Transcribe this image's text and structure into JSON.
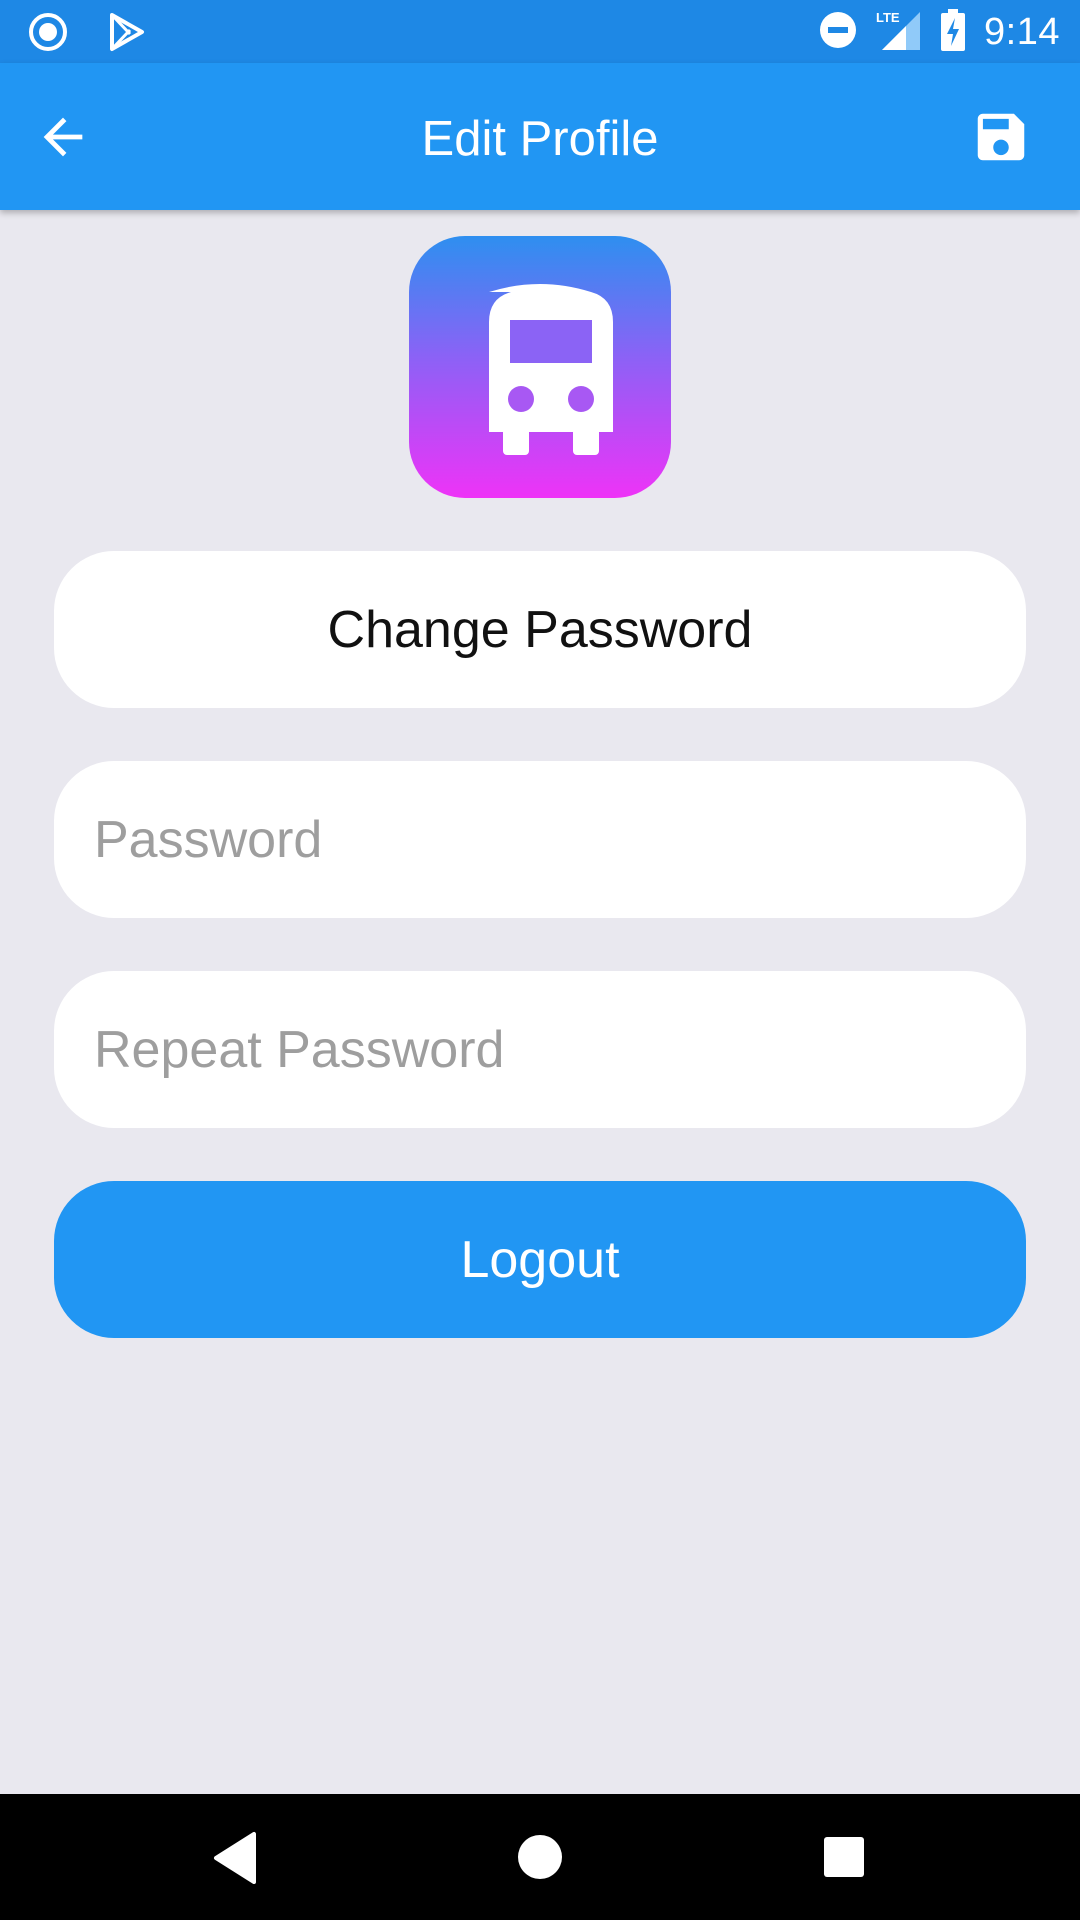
{
  "status_bar": {
    "time": "9:14",
    "network": "LTE",
    "icons": [
      "record-icon",
      "play-store-icon",
      "do-not-disturb-icon",
      "lte-signal-icon",
      "battery-charging-icon"
    ]
  },
  "app_bar": {
    "title": "Edit Profile",
    "back_icon": "arrow-back-icon",
    "save_icon": "save-icon"
  },
  "logo": {
    "icon": "bus-icon",
    "gradient": [
      "#2E8FF0",
      "#8F60F6",
      "#EE33F7"
    ]
  },
  "form": {
    "heading": "Change Password",
    "password_placeholder": "Password",
    "password_value": "",
    "repeat_password_placeholder": "Repeat Password",
    "repeat_password_value": "",
    "logout_label": "Logout"
  },
  "nav_bar": {
    "icons": [
      "nav-back-icon",
      "nav-home-icon",
      "nav-recents-icon"
    ]
  },
  "colors": {
    "primary": "#2196F3",
    "status_bar": "#1E88E5",
    "background": "#E9E8EF"
  }
}
